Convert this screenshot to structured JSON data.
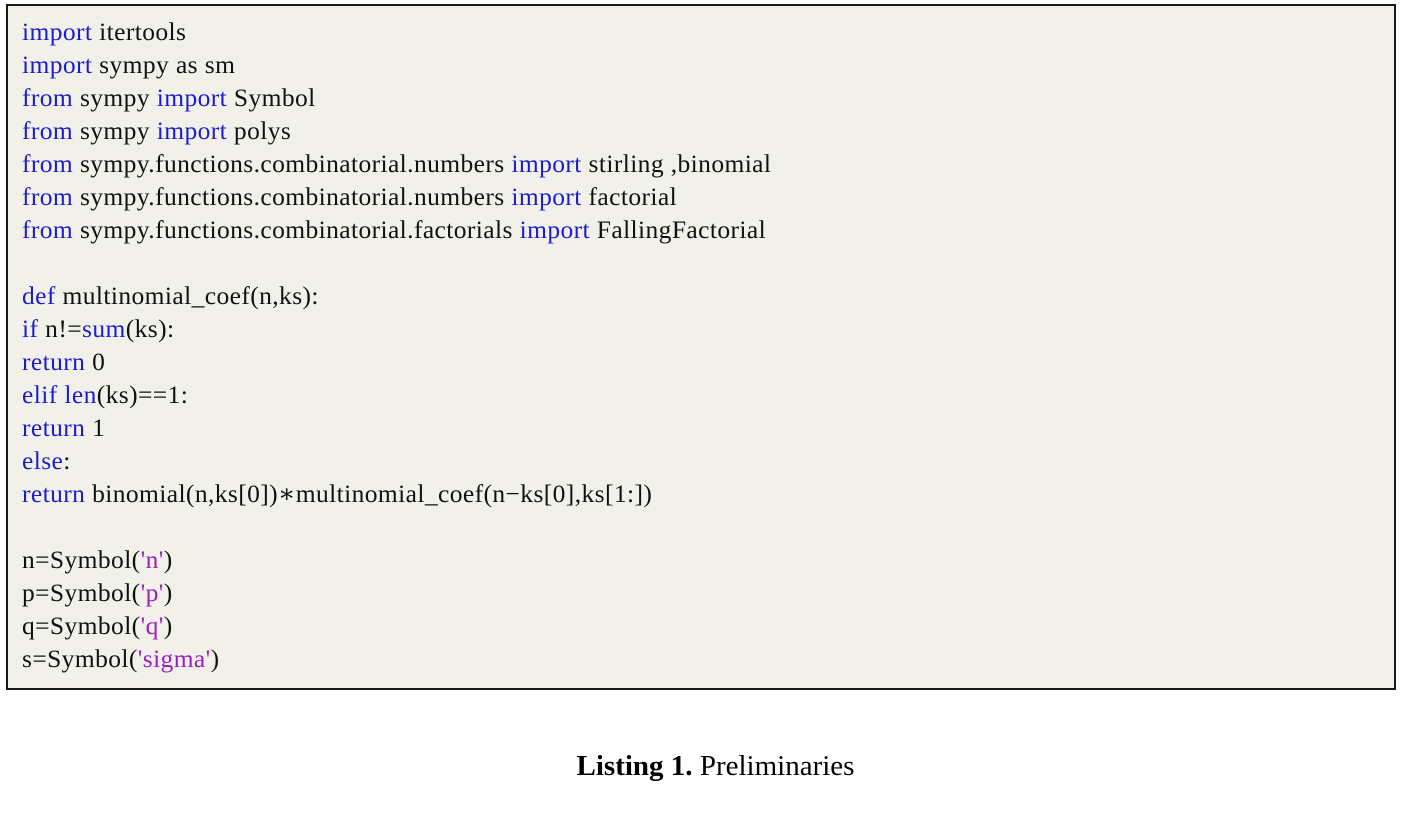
{
  "listing": {
    "language": "python",
    "background_color": "#f1f1ea",
    "border_color": "#1a1a1a",
    "colors": {
      "keyword": "#1c1ccc",
      "builtin": "#1c1ccc",
      "string": "#9c1fbe",
      "plain": "#111111"
    },
    "lines": [
      {
        "index": 1,
        "text": "import itertools",
        "tokens": [
          {
            "t": "import",
            "c": "kw"
          },
          {
            "t": " itertools",
            "c": "plain"
          }
        ]
      },
      {
        "index": 2,
        "text": "import sympy as sm",
        "tokens": [
          {
            "t": "import",
            "c": "kw"
          },
          {
            "t": " sympy as sm",
            "c": "plain"
          }
        ]
      },
      {
        "index": 3,
        "text": "from sympy import Symbol",
        "tokens": [
          {
            "t": "from",
            "c": "kw"
          },
          {
            "t": " sympy ",
            "c": "plain"
          },
          {
            "t": "import",
            "c": "kw"
          },
          {
            "t": " Symbol",
            "c": "plain"
          }
        ]
      },
      {
        "index": 4,
        "text": "from sympy import polys",
        "tokens": [
          {
            "t": "from",
            "c": "kw"
          },
          {
            "t": " sympy ",
            "c": "plain"
          },
          {
            "t": "import",
            "c": "kw"
          },
          {
            "t": " polys",
            "c": "plain"
          }
        ]
      },
      {
        "index": 5,
        "text": "from sympy.functions.combinatorial.numbers import stirling,binomial",
        "tokens": [
          {
            "t": "from",
            "c": "kw"
          },
          {
            "t": " sympy.functions.combinatorial.numbers ",
            "c": "plain"
          },
          {
            "t": "import",
            "c": "kw"
          },
          {
            "t": " stirling ,binomial",
            "c": "plain"
          }
        ]
      },
      {
        "index": 6,
        "text": "from sympy.functions.combinatorial.numbers import factorial",
        "tokens": [
          {
            "t": "from",
            "c": "kw"
          },
          {
            "t": " sympy.functions.combinatorial.numbers ",
            "c": "plain"
          },
          {
            "t": "import",
            "c": "kw"
          },
          {
            "t": " factorial",
            "c": "plain"
          }
        ]
      },
      {
        "index": 7,
        "text": "from sympy.functions.combinatorial.factorials import FallingFactorial",
        "tokens": [
          {
            "t": "from",
            "c": "kw"
          },
          {
            "t": " sympy.functions.combinatorial.factorials ",
            "c": "plain"
          },
          {
            "t": "import",
            "c": "kw"
          },
          {
            "t": " FallingFactorial",
            "c": "plain"
          }
        ]
      },
      {
        "index": 8,
        "text": "",
        "tokens": []
      },
      {
        "index": 9,
        "text": "def multinomial_coef(n,ks):",
        "tokens": [
          {
            "t": "def",
            "c": "kw"
          },
          {
            "t": " multinomial_coef(n,ks):",
            "c": "plain"
          }
        ]
      },
      {
        "index": 10,
        "text": "if n!=sum(ks):",
        "tokens": [
          {
            "t": "if",
            "c": "kw"
          },
          {
            "t": " n!=",
            "c": "plain"
          },
          {
            "t": "sum",
            "c": "builtin"
          },
          {
            "t": "(ks):",
            "c": "plain"
          }
        ]
      },
      {
        "index": 11,
        "text": "return 0",
        "tokens": [
          {
            "t": "return",
            "c": "kw"
          },
          {
            "t": " 0",
            "c": "plain"
          }
        ]
      },
      {
        "index": 12,
        "text": "elif len(ks)==1:",
        "tokens": [
          {
            "t": "elif",
            "c": "kw"
          },
          {
            "t": " ",
            "c": "plain"
          },
          {
            "t": "len",
            "c": "builtin"
          },
          {
            "t": "(ks)==1:",
            "c": "plain"
          }
        ]
      },
      {
        "index": 13,
        "text": "return 1",
        "tokens": [
          {
            "t": "return",
            "c": "kw"
          },
          {
            "t": " 1",
            "c": "plain"
          }
        ]
      },
      {
        "index": 14,
        "text": "else:",
        "tokens": [
          {
            "t": "else",
            "c": "kw"
          },
          {
            "t": ":",
            "c": "plain"
          }
        ]
      },
      {
        "index": 15,
        "text": "return binomial(n,ks[0])*multinomial_coef(n-ks[0],ks[1:])",
        "tokens": [
          {
            "t": "return",
            "c": "kw"
          },
          {
            "t": " binomial(n,ks[0])∗multinomial_coef(n−ks[0],ks[1:])",
            "c": "plain"
          }
        ]
      },
      {
        "index": 16,
        "text": "",
        "tokens": []
      },
      {
        "index": 17,
        "text": "n=Symbol('n')",
        "tokens": [
          {
            "t": "n=Symbol(",
            "c": "plain"
          },
          {
            "t": "'n'",
            "c": "str"
          },
          {
            "t": ")",
            "c": "plain"
          }
        ]
      },
      {
        "index": 18,
        "text": "p=Symbol('p')",
        "tokens": [
          {
            "t": "p=Symbol(",
            "c": "plain"
          },
          {
            "t": "'p'",
            "c": "str"
          },
          {
            "t": ")",
            "c": "plain"
          }
        ]
      },
      {
        "index": 19,
        "text": "q=Symbol('q')",
        "tokens": [
          {
            "t": "q=Symbol(",
            "c": "plain"
          },
          {
            "t": "'q'",
            "c": "str"
          },
          {
            "t": ")",
            "c": "plain"
          }
        ]
      },
      {
        "index": 20,
        "text": "s=Symbol('sigma')",
        "tokens": [
          {
            "t": "s=Symbol(",
            "c": "plain"
          },
          {
            "t": "'sigma'",
            "c": "str"
          },
          {
            "t": ")",
            "c": "plain"
          }
        ]
      }
    ]
  },
  "caption": {
    "label": "Listing 1.",
    "text": " Preliminaries"
  }
}
